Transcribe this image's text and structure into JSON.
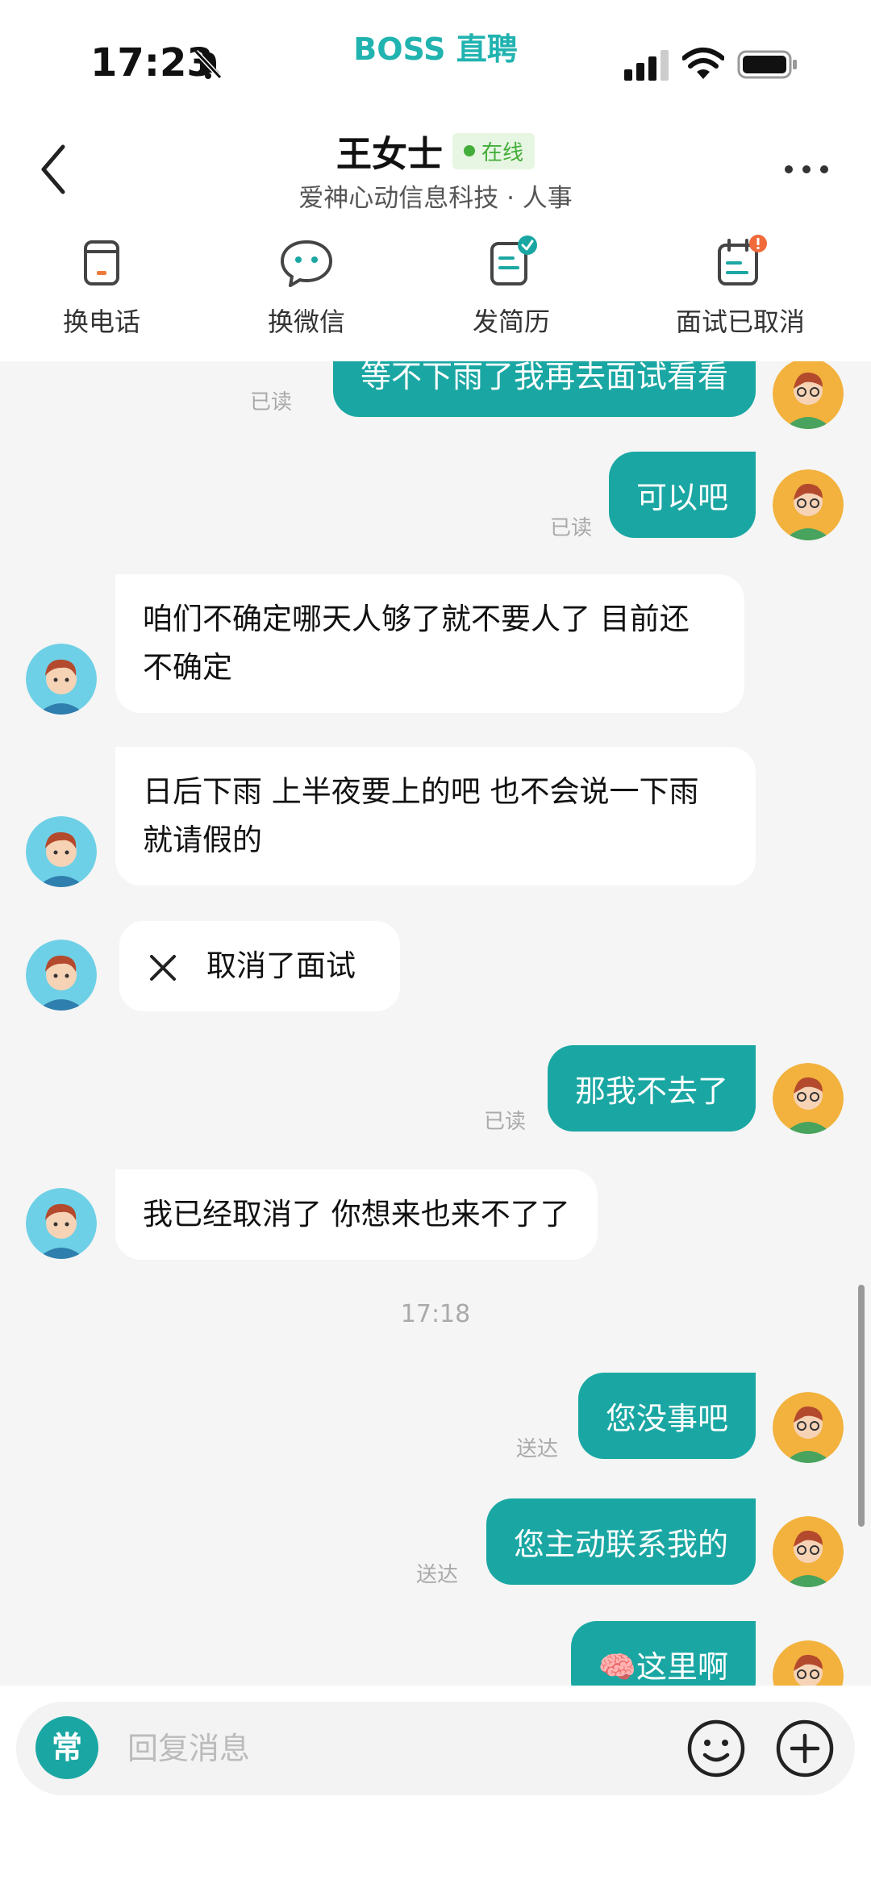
{
  "status_bar": {
    "time": "17:23",
    "brand": "BOSS 直聘"
  },
  "header": {
    "contact_name": "王女士",
    "online_label": "在线",
    "subtitle": "爱神心动信息科技 · 人事"
  },
  "actions": [
    {
      "label": "换电话",
      "icon": "phone-card-icon"
    },
    {
      "label": "换微信",
      "icon": "wechat-icon"
    },
    {
      "label": "发简历",
      "icon": "resume-icon"
    },
    {
      "label": "面试已取消",
      "icon": "calendar-icon"
    }
  ],
  "messages": {
    "m1_text": "等不下雨了我再去面试看看",
    "m1_status": "已读",
    "m2_text": "可以吧",
    "m2_status": "已读",
    "m3_text": "咱们不确定哪天人够了就不要人了 目前还不确定",
    "m4_text": "日后下雨 上半夜要上的吧 也不会说一下雨就请假的",
    "m5_text": "取消了面试",
    "m6_text": "那我不去了",
    "m6_status": "已读",
    "m7_text": "我已经取消了 你想来也来不了了",
    "timestamp": "17:18",
    "m8_text": "您没事吧",
    "m8_status": "送达",
    "m9_text": "您主动联系我的",
    "m9_status": "送达",
    "m10_text": "🧠这里啊"
  },
  "input": {
    "common_label": "常",
    "placeholder": "回复消息"
  },
  "colors": {
    "accent": "#1aa7a3",
    "online": "#43ad3a",
    "brand": "#21b3b0"
  }
}
